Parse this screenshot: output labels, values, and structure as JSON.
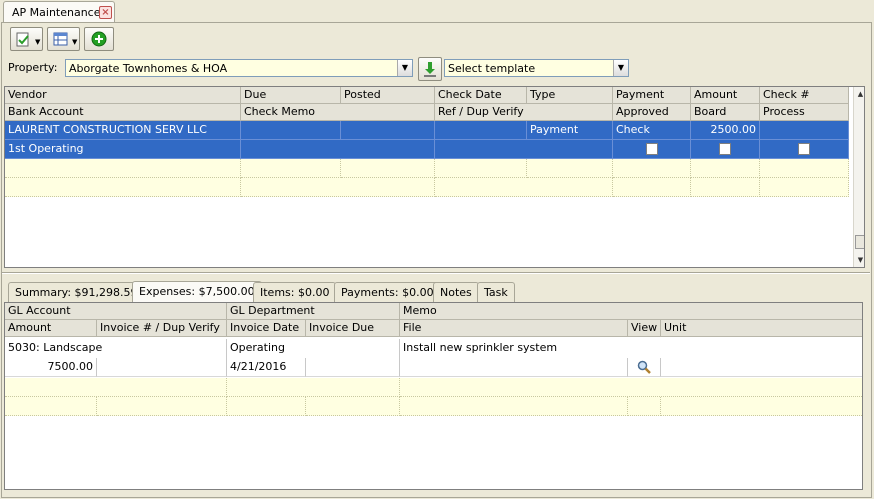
{
  "window": {
    "tab_title": "AP Maintenance"
  },
  "property": {
    "label": "Property:",
    "value": "Aborgate Townhomes & HOA",
    "template_value": "Select template"
  },
  "top_grid": {
    "header1": [
      "Vendor",
      "Due",
      "Posted",
      "Check Date",
      "Type",
      "Payment",
      "Amount",
      "Check #"
    ],
    "header2": [
      "Bank Account",
      "Check Memo",
      "",
      "Ref / Dup Verify",
      "",
      "Approved",
      "Board",
      "Process"
    ],
    "row1": [
      "LAURENT CONSTRUCTION SERV LLC",
      "",
      "",
      "",
      "Payment",
      "Check",
      "2500.00",
      ""
    ],
    "row2": {
      "bank_account": "1st Operating",
      "approved": false,
      "board": false,
      "process": false
    }
  },
  "tabs": [
    {
      "label": "Summary: $91,298.59"
    },
    {
      "label": "Expenses: $7,500.00"
    },
    {
      "label": "Items: $0.00"
    },
    {
      "label": "Payments: $0.00"
    },
    {
      "label": "Notes"
    },
    {
      "label": "Task"
    }
  ],
  "active_tab": "Expenses: $7,500.00",
  "bottom_grid": {
    "header1": [
      "GL Account",
      "GL Department",
      "Memo"
    ],
    "header2": [
      "Amount",
      "Invoice # / Dup Verify",
      "Invoice Date",
      "Invoice Due",
      "File",
      "View",
      "Unit"
    ],
    "row1": {
      "gl_account": "5030: Landscape",
      "gl_department": "Operating",
      "memo": "Install new sprinkler system"
    },
    "row2": {
      "amount": "7500.00",
      "invoice_date": "4/21/2016"
    }
  },
  "colors": {
    "selection": "#316ac5",
    "editable": "#ffffe1"
  },
  "icons": [
    "document-check-icon",
    "grid-layout-icon",
    "add-icon",
    "download-icon",
    "close-icon",
    "search-icon"
  ]
}
